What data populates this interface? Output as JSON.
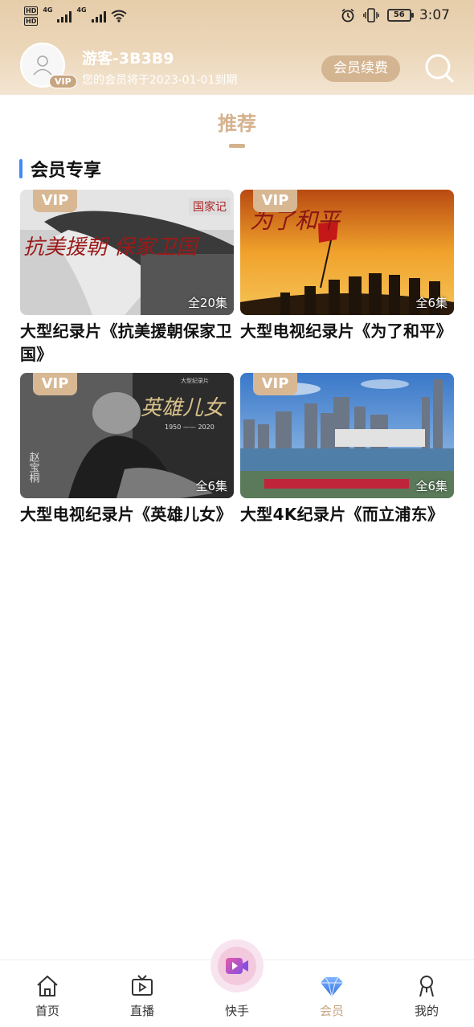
{
  "status_bar": {
    "time": "3:07",
    "battery": "56",
    "network_1": "4G",
    "network_2": "4G",
    "hd_1": "HD",
    "hd_2": "HD"
  },
  "header": {
    "user_name": "游客-3B3B9",
    "expire_text": "您的会员将于2023-01-01到期",
    "vip_badge": "VIP",
    "renew_label": "会员续费",
    "avatar_icon": "user-icon",
    "search_icon": "search-icon"
  },
  "tabs": {
    "recommend": "推荐"
  },
  "section": {
    "title": "会员专享",
    "accent_color": "#3f8cf5"
  },
  "cards": [
    {
      "vip": "VIP",
      "episodes": "全20集",
      "title": "大型纪录片《抗美援朝保家卫国》",
      "thumb_text": "抗美援朝 保家卫国",
      "channel_logo": "国家记"
    },
    {
      "vip": "VIP",
      "episodes": "全6集",
      "title": "大型电视纪录片《为了和平》",
      "thumb_text": "为了和平"
    },
    {
      "vip": "VIP",
      "episodes": "全6集",
      "title": "大型电视纪录片《英雄儿女》",
      "thumb_text": "英雄儿女",
      "thumb_sub": "1950 —— 2020",
      "thumb_name": "赵宝桐",
      "thumb_small": "大型纪录片"
    },
    {
      "vip": "VIP",
      "episodes": "全6集",
      "title": "大型4K纪录片《而立浦东》"
    }
  ],
  "nav": [
    {
      "label": "首页",
      "icon": "home-icon"
    },
    {
      "label": "直播",
      "icon": "tv-icon"
    },
    {
      "label": "快手",
      "icon": "video-play-icon"
    },
    {
      "label": "会员",
      "icon": "diamond-icon"
    },
    {
      "label": "我的",
      "icon": "profile-icon"
    }
  ],
  "colors": {
    "gold": "#d5b28e",
    "header_gradient_top": "#e6cdaa",
    "nav_active": "#c7a581"
  }
}
